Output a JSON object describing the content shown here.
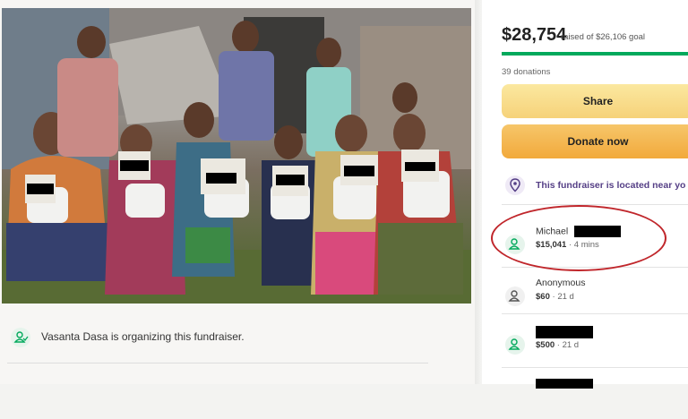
{
  "campaign_photo": {
    "alt": "Group of children and women holding rice bags and THANK YOU signs"
  },
  "organizer": {
    "text": "Vasanta Dasa is organizing this fundraiser."
  },
  "summary": {
    "amount": "$28,754",
    "goal_text": "raised of $26,106 goal",
    "progress_fraction": 1.0,
    "donations": "39 donations"
  },
  "buttons": {
    "share": "Share",
    "donate": "Donate now"
  },
  "location": {
    "text": "This fundraiser is located near yo"
  },
  "donors": [
    {
      "name": "Michael",
      "name_redacted": true,
      "amount": "$15,041",
      "time": "4 mins"
    },
    {
      "name": "Anonymous",
      "name_redacted": false,
      "amount": "$60",
      "time": "21 d"
    },
    {
      "name": "",
      "name_redacted": true,
      "amount": "$500",
      "time": "21 d"
    }
  ],
  "colors": {
    "accent_green": "#02a95c",
    "share_button": "#f6d27a",
    "donate_button": "#f2a93b",
    "location_text": "#553f86",
    "highlight": "#c0262b"
  },
  "icons": [
    "location-pin-icon",
    "donor-icon",
    "organizer-icon"
  ]
}
